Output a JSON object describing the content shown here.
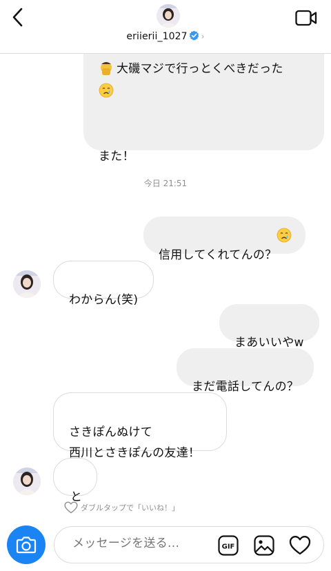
{
  "header": {
    "username": "eriierii_1027",
    "chevron": "›"
  },
  "thread": {
    "top_bubble_lines": [
      "大磯マジで行っとくべきだった",
      "",
      "また！"
    ],
    "timestamp": "今日 21:51",
    "messages": [
      {
        "side": "out",
        "text": "信用してくれてんの？",
        "emoji": "crying-face"
      },
      {
        "side": "in",
        "text": "わからん(笑)"
      },
      {
        "side": "out",
        "text": "まあいいやw"
      },
      {
        "side": "out",
        "text": "まだ電話してんの？"
      },
      {
        "side": "in",
        "text": "さきぽんぬけて\n西川とさきぽんの友達！"
      },
      {
        "side": "in",
        "text": "と"
      }
    ],
    "like_hint": "ダブルタップで「いいね！」"
  },
  "composer": {
    "placeholder": "メッセージを送る...",
    "gif_label": "GIF"
  },
  "colors": {
    "accent": "#1b84f5",
    "outgoing_bubble": "#efefef",
    "incoming_border": "#dbdbdb",
    "verified": "#3897f0"
  },
  "icons": [
    "back-chevron-icon",
    "video-call-icon",
    "verified-badge-icon",
    "camera-icon",
    "gif-icon",
    "image-icon",
    "heart-icon",
    "crying-face-emoji"
  ]
}
